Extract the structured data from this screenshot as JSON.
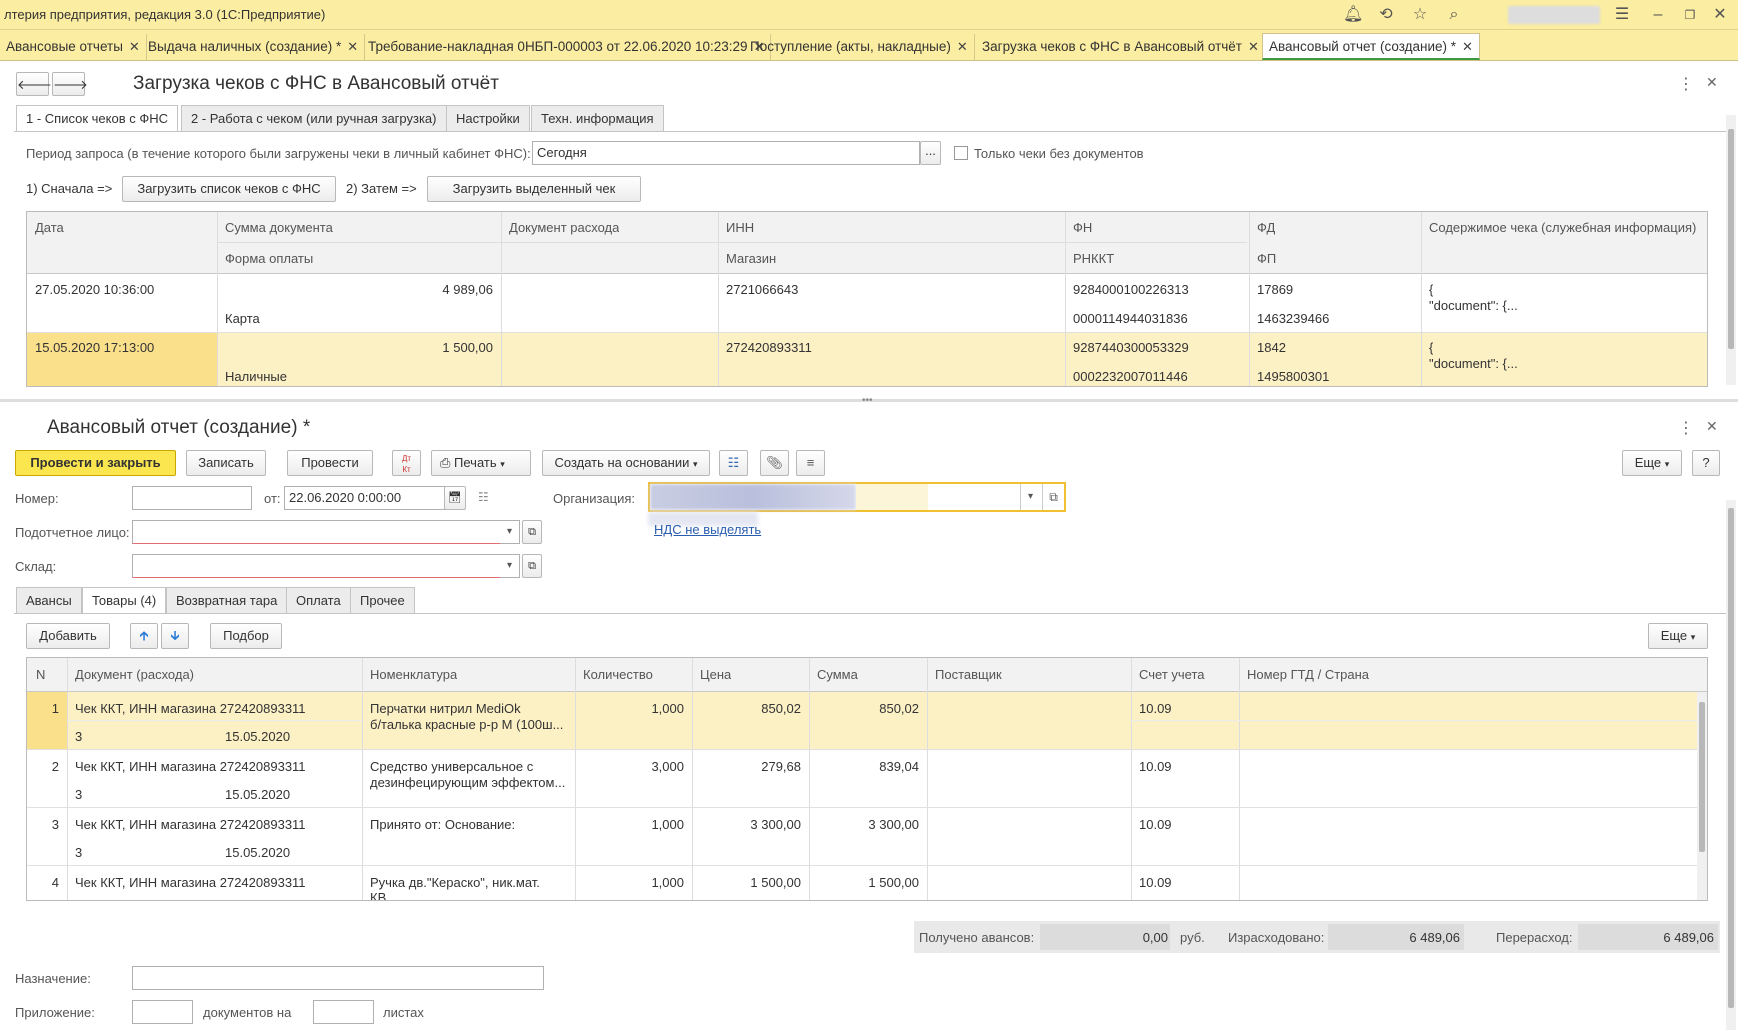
{
  "app": {
    "title": "лтерия предприятия, редакция 3.0  (1С:Предприятие)"
  },
  "colors": {
    "accent_yellow": "#fbe64f",
    "header_bg": "#fbeda1",
    "selected_row": "#fcf0c5",
    "active_tab_underline": "#3c9a3c"
  },
  "open_tabs": [
    {
      "label": "Авансовые отчеты"
    },
    {
      "label": "Выдача наличных (создание) *"
    },
    {
      "label": "Требование-накладная 0НБП-000003 от 22.06.2020 10:23:29"
    },
    {
      "label": "Поступление (акты, накладные)"
    },
    {
      "label": "Загрузка чеков с ФНС в Авансовый отчёт"
    },
    {
      "label": "Авансовый отчет (создание) *"
    }
  ],
  "top_form": {
    "title": "Загрузка чеков с ФНС в Авансовый отчёт",
    "tabs": [
      "1 - Список чеков с ФНС",
      "2 - Работа с чеком (или ручная загрузка)",
      "Настройки",
      "Техн. информация"
    ],
    "period_label": "Период запроса (в течение которого были загружены чеки в личный кабинет ФНС):",
    "period_value": "Сегодня",
    "only_no_docs_label": "Только чеки без документов",
    "step1_label": "1) Сначала =>",
    "load_list_button": "Загрузить список чеков с ФНС",
    "step2_label": "2) Затем =>",
    "load_selected_button": "Загрузить выделенный чек",
    "columns": {
      "date": "Дата",
      "sum": "Сумма документа",
      "pay_form": "Форма оплаты",
      "doc": "Документ расхода",
      "inn": "ИНН",
      "shop": "Магазин",
      "fn": "ФН",
      "rnkkt": "РНККТ",
      "fd": "ФД",
      "fp": "ФП",
      "content": "Содержимое чека (служебная информация)"
    },
    "rows": [
      {
        "date": "27.05.2020 10:36:00",
        "sum": "4 989,06",
        "pay_form": "Карта",
        "doc": "",
        "inn": "2721066643",
        "shop": "",
        "fn": "9284000100226313",
        "rnkkt": "0000114944031836",
        "fd": "17869",
        "fp": "1463239466",
        "content1": "{",
        "content2": "\"document\": {..."
      },
      {
        "date": "15.05.2020 17:13:00",
        "sum": "1 500,00",
        "pay_form": "Наличные",
        "doc": "",
        "inn": "272420893311",
        "shop": "",
        "fn": "9287440300053329",
        "rnkkt": "0002232007011446",
        "fd": "1842",
        "fp": "1495800301",
        "content1": "{",
        "content2": "\"document\": {..."
      }
    ]
  },
  "bottom_form": {
    "title": "Авансовый отчет (создание) *",
    "toolbar": {
      "post_close": "Провести и закрыть",
      "save": "Записать",
      "post": "Провести",
      "dtkt": "Дт Кт",
      "print": "Печать",
      "create_based": "Создать на основании",
      "more": "Еще",
      "help": "?"
    },
    "number_label": "Номер:",
    "number_value": "",
    "from_label": "от:",
    "date_value": "22.06.2020  0:00:00",
    "org_label": "Организация:",
    "org_link": "НДС не выделять",
    "person_label": "Подотчетное лицо:",
    "warehouse_label": "Склад:",
    "tabs": [
      "Авансы",
      "Товары (4)",
      "Возвратная тара",
      "Оплата",
      "Прочее"
    ],
    "add_button": "Добавить",
    "pick_button": "Подбор",
    "more_button": "Еще",
    "columns": {
      "n": "N",
      "doc": "Документ (расхода)",
      "nom": "Номенклатура",
      "qty": "Количество",
      "price": "Цена",
      "sum": "Сумма",
      "supplier": "Поставщик",
      "account": "Счет учета",
      "gtd": "Номер ГТД / Страна"
    },
    "rows": [
      {
        "n": "1",
        "doc": "Чек ККТ, ИНН магазина 272420893311",
        "doc_num": "3",
        "doc_date": "15.05.2020",
        "nom1": "Перчатки нитрил MediOk",
        "nom2": "б/талька красные р-р M (100ш...",
        "qty": "1,000",
        "price": "850,02",
        "sum": "850,02",
        "account": "10.09"
      },
      {
        "n": "2",
        "doc": "Чек ККТ, ИНН магазина 272420893311",
        "doc_num": "3",
        "doc_date": "15.05.2020",
        "nom1": "Средство универсальное с",
        "nom2": "дезинфецирующим эффектом...",
        "qty": "3,000",
        "price": "279,68",
        "sum": "839,04",
        "account": "10.09"
      },
      {
        "n": "3",
        "doc": "Чек ККТ, ИНН магазина 272420893311",
        "doc_num": "3",
        "doc_date": "15.05.2020",
        "nom1": "Принято от:  Основание:",
        "nom2": "",
        "qty": "1,000",
        "price": "3 300,00",
        "sum": "3 300,00",
        "account": "10.09"
      },
      {
        "n": "4",
        "doc": "Чек ККТ, ИНН магазина 272420893311",
        "doc_num": "",
        "doc_date": "",
        "nom1": "Ручка дв.\"Кераско\", ник.мат.",
        "nom2": "КВ",
        "qty": "1,000",
        "price": "1 500,00",
        "sum": "1 500,00",
        "account": "10.09"
      }
    ],
    "totals": {
      "received_label": "Получено авансов:",
      "received": "0,00",
      "currency": "руб.",
      "spent_label": "Израсходовано:",
      "spent": "6 489,06",
      "overspend_label": "Перерасход:",
      "overspend": "6 489,06"
    },
    "purpose_label": "Назначение:",
    "attachment_label": "Приложение:",
    "docs_on_label": "документов на",
    "sheets_label": "листах"
  }
}
